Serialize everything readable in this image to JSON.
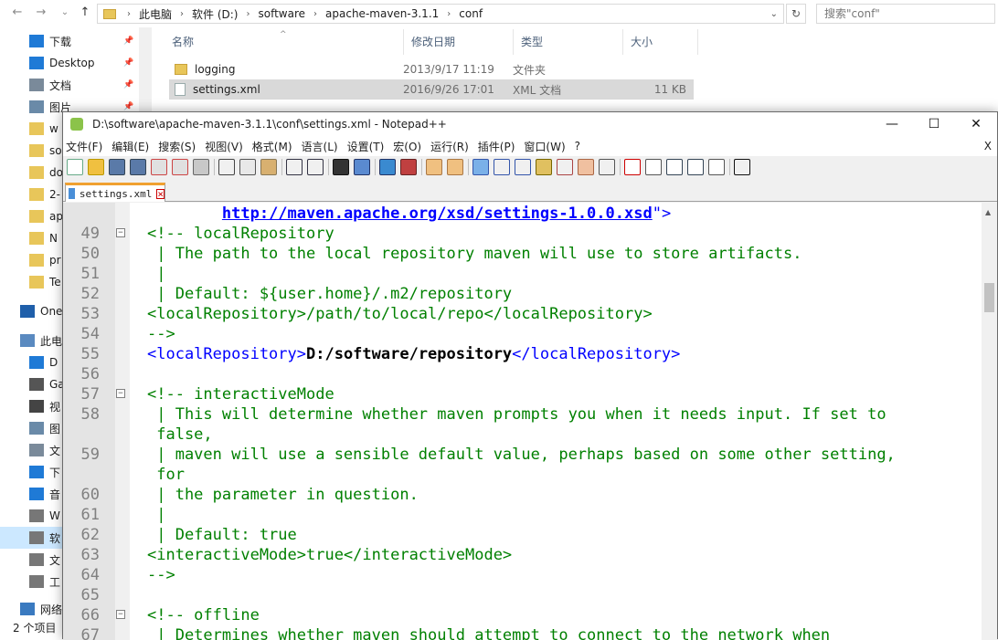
{
  "explorer": {
    "breadcrumb": [
      "此电脑",
      "软件 (D:)",
      "software",
      "apache-maven-3.1.1",
      "conf"
    ],
    "search_placeholder": "搜索\"conf\"",
    "columns": [
      "名称",
      "修改日期",
      "类型",
      "大小"
    ],
    "files": [
      {
        "name": "logging",
        "date": "2013/9/17 11:19",
        "type": "文件夹",
        "size": ""
      },
      {
        "name": "settings.xml",
        "date": "2016/9/26 17:01",
        "type": "XML 文档",
        "size": "11 KB"
      }
    ],
    "sidebar": [
      {
        "label": "下载",
        "icon": "download-icon",
        "pin": true
      },
      {
        "label": "Desktop",
        "icon": "desktop-icon",
        "pin": true
      },
      {
        "label": "文档",
        "icon": "document-icon",
        "pin": true
      },
      {
        "label": "图片",
        "icon": "picture-icon",
        "pin": true
      },
      {
        "label": "w",
        "icon": "folder-icon"
      },
      {
        "label": "so",
        "icon": "folder-icon"
      },
      {
        "label": "do",
        "icon": "folder-icon"
      },
      {
        "label": "2-",
        "icon": "folder-icon"
      },
      {
        "label": "ap",
        "icon": "folder-icon"
      },
      {
        "label": "N",
        "icon": "folder-icon"
      },
      {
        "label": "pr",
        "icon": "folder-icon"
      },
      {
        "label": "Te",
        "icon": "folder-icon"
      },
      {
        "label": "One",
        "icon": "onedrive-icon"
      },
      {
        "label": "此电",
        "icon": "computer-icon"
      },
      {
        "label": "D",
        "icon": "desktop-icon"
      },
      {
        "label": "Ga",
        "icon": "disk-icon"
      },
      {
        "label": "视",
        "icon": "video-icon"
      },
      {
        "label": "图",
        "icon": "picture-icon"
      },
      {
        "label": "文",
        "icon": "document-icon"
      },
      {
        "label": "下",
        "icon": "download-icon"
      },
      {
        "label": "音",
        "icon": "music-icon"
      },
      {
        "label": "W",
        "icon": "drive-icon"
      },
      {
        "label": "软",
        "icon": "drive-icon",
        "selected": true
      },
      {
        "label": "文",
        "icon": "drive-icon"
      },
      {
        "label": "工",
        "icon": "drive-icon"
      },
      {
        "label": "网络",
        "icon": "network-icon"
      }
    ],
    "status": "2 个项目"
  },
  "npp": {
    "title": "D:\\software\\apache-maven-3.1.1\\conf\\settings.xml - Notepad++",
    "menu": [
      "文件(F)",
      "编辑(E)",
      "搜索(S)",
      "视图(V)",
      "格式(M)",
      "语言(L)",
      "设置(T)",
      "宏(O)",
      "运行(R)",
      "插件(P)",
      "窗口(W)",
      "?"
    ],
    "menu_close": "X",
    "tab": "settings.xml",
    "lines": [
      {
        "n": "",
        "fold": false,
        "parts": [
          {
            "c": "url",
            "t": "http://maven.apache.org/xsd/settings-1.0.0.xsd"
          },
          {
            "c": "tag",
            "t": "\">"
          }
        ],
        "indent": "        "
      },
      {
        "n": "49",
        "fold": true,
        "parts": [
          {
            "c": "cm",
            "t": "<!-- localRepository"
          }
        ]
      },
      {
        "n": "50",
        "fold": false,
        "parts": [
          {
            "c": "cm",
            "t": " | The path to the local repository maven will use to store artifacts."
          }
        ]
      },
      {
        "n": "51",
        "fold": false,
        "parts": [
          {
            "c": "cm",
            "t": " |"
          }
        ]
      },
      {
        "n": "52",
        "fold": false,
        "parts": [
          {
            "c": "cm",
            "t": " | Default: ${user.home}/.m2/repository"
          }
        ]
      },
      {
        "n": "53",
        "fold": false,
        "parts": [
          {
            "c": "cm",
            "t": "<localRepository>/path/to/local/repo</localRepository>"
          }
        ]
      },
      {
        "n": "54",
        "fold": false,
        "parts": [
          {
            "c": "cm",
            "t": "-->"
          }
        ]
      },
      {
        "n": "55",
        "fold": false,
        "parts": [
          {
            "c": "tag",
            "t": "<localRepository>"
          },
          {
            "c": "txt bold",
            "t": "D:/software/repository"
          },
          {
            "c": "tag",
            "t": "</localRepository>"
          }
        ]
      },
      {
        "n": "56",
        "fold": false,
        "parts": []
      },
      {
        "n": "57",
        "fold": true,
        "parts": [
          {
            "c": "cm",
            "t": "<!-- interactiveMode"
          }
        ]
      },
      {
        "n": "58",
        "fold": false,
        "parts": [
          {
            "c": "cm",
            "t": " | This will determine whether maven prompts you when it needs input. If set to"
          }
        ]
      },
      {
        "n": "",
        "fold": false,
        "parts": [
          {
            "c": "cm",
            "t": " false,"
          }
        ]
      },
      {
        "n": "59",
        "fold": false,
        "parts": [
          {
            "c": "cm",
            "t": " | maven will use a sensible default value, perhaps based on some other setting,"
          }
        ]
      },
      {
        "n": "",
        "fold": false,
        "parts": [
          {
            "c": "cm",
            "t": " for"
          }
        ]
      },
      {
        "n": "60",
        "fold": false,
        "parts": [
          {
            "c": "cm",
            "t": " | the parameter in question."
          }
        ]
      },
      {
        "n": "61",
        "fold": false,
        "parts": [
          {
            "c": "cm",
            "t": " |"
          }
        ]
      },
      {
        "n": "62",
        "fold": false,
        "parts": [
          {
            "c": "cm",
            "t": " | Default: true"
          }
        ]
      },
      {
        "n": "63",
        "fold": false,
        "parts": [
          {
            "c": "cm",
            "t": "<interactiveMode>true</interactiveMode>"
          }
        ]
      },
      {
        "n": "64",
        "fold": false,
        "parts": [
          {
            "c": "cm",
            "t": "-->"
          }
        ]
      },
      {
        "n": "65",
        "fold": false,
        "parts": []
      },
      {
        "n": "66",
        "fold": true,
        "parts": [
          {
            "c": "cm",
            "t": "<!-- offline"
          }
        ]
      },
      {
        "n": "67",
        "fold": false,
        "parts": [
          {
            "c": "cm",
            "t": " | Determines whether maven should attempt to connect to the network when"
          }
        ]
      }
    ]
  }
}
